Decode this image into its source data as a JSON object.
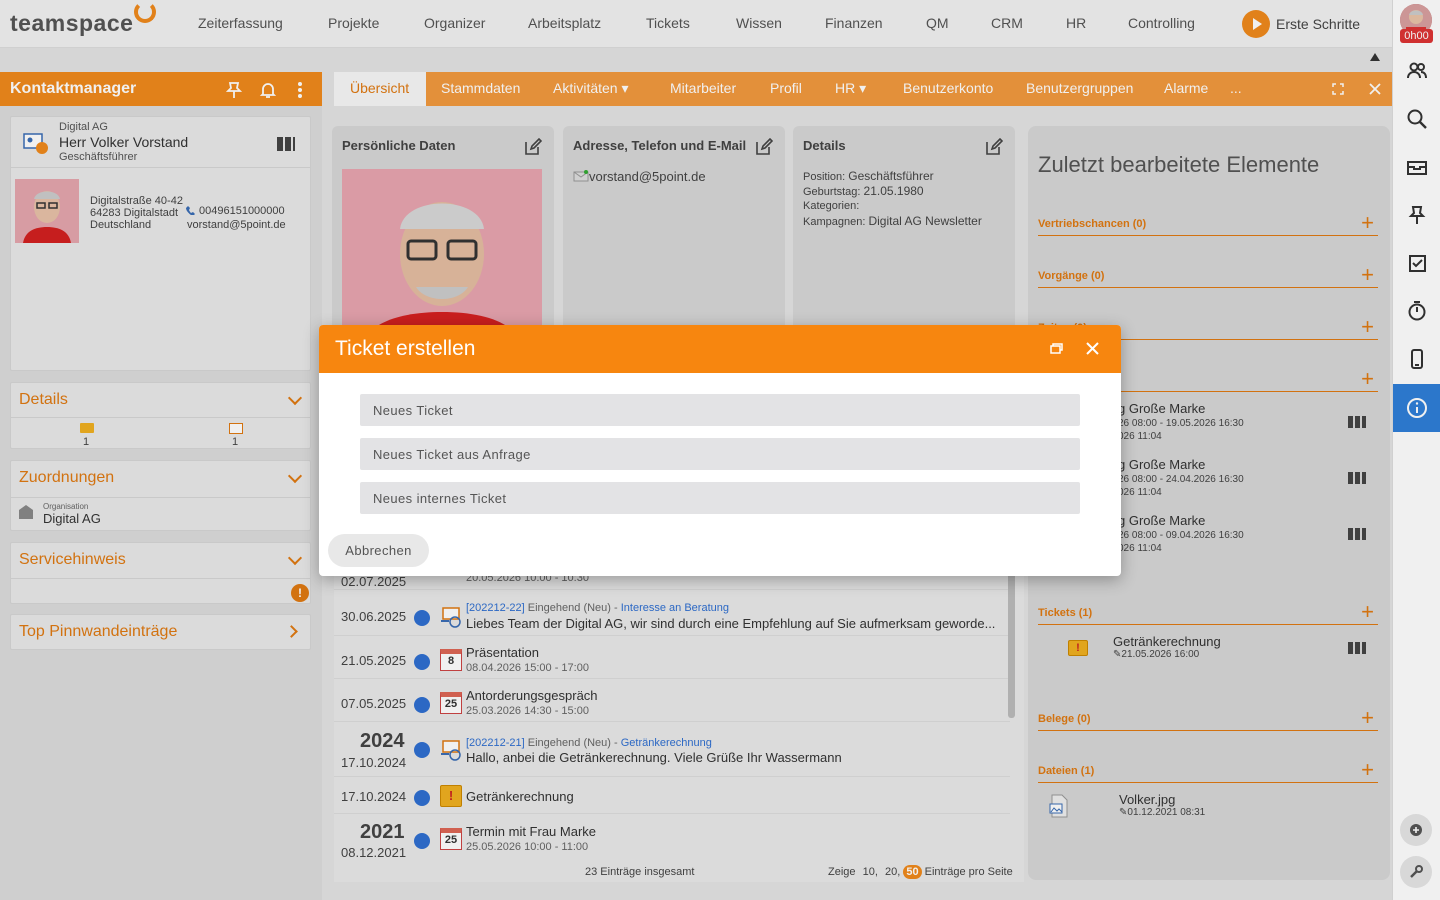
{
  "app": {
    "logo": "teamspace"
  },
  "topnav": {
    "items": [
      "Zeiterfassung",
      "Projekte",
      "Organizer",
      "Arbeitsplatz",
      "Tickets",
      "Wissen",
      "Finanzen",
      "QM",
      "CRM",
      "HR",
      "Controlling"
    ],
    "erste_schritte": "Erste Schritte",
    "time_badge": "0h00"
  },
  "left": {
    "panel_title": "Kontaktmanager",
    "contact": {
      "org": "Digital AG",
      "name": "Herr Volker Vorstand",
      "role": "Geschäftsführer",
      "street": "Digitalstraße 40-42",
      "city": "64283 Digitalstadt",
      "country": "Deutschland",
      "phone": "00496151000000",
      "email": "vorstand@5point.de"
    },
    "details": {
      "title": "Details",
      "count1": "1",
      "count2": "1"
    },
    "zuordnungen": {
      "title": "Zuordnungen",
      "type": "Organisation",
      "value": "Digital AG"
    },
    "servicehinweis": {
      "title": "Servicehinweis"
    },
    "pinnwand": {
      "title": "Top Pinnwandeinträge"
    }
  },
  "tabs": [
    "Übersicht",
    "Stammdaten",
    "Aktivitäten ▾",
    "Mitarbeiter",
    "Profil",
    "HR ▾",
    "Benutzerkonto",
    "Benutzergruppen",
    "Alarme",
    "..."
  ],
  "boxes": {
    "personal": {
      "title": "Persönliche Daten"
    },
    "address": {
      "title": "Adresse, Telefon und E-Mail",
      "email": "vorstand@5point.de"
    },
    "details": {
      "title": "Details",
      "position_label": "Position:",
      "position": "Geschäftsführer",
      "birthday_label": "Geburtstag:",
      "birthday": "21.05.1980",
      "kategorien_label": "Kategorien:",
      "kampagnen_label": "Kampagnen:",
      "kampagnen": "Digital AG Newsletter"
    }
  },
  "recent": {
    "title": "Zuletzt bearbeitete Elemente",
    "sections": {
      "vertrieb": "Vertriebschancen (0)",
      "vorgaenge": "Vorgänge (0)",
      "zeiten": "Zeiten (0)",
      "tickets": "Tickets (1)",
      "belege": "Belege (0)",
      "dateien": "Dateien (1)"
    },
    "termine": [
      {
        "title": "g Große Marke",
        "range": "26 08:00 - 19.05.2026 16:30",
        "edited": "026 11:04"
      },
      {
        "title": "g Große Marke",
        "range": "26 08:00 - 24.04.2026 16:30",
        "edited": "026 11:04"
      },
      {
        "title": "g Große Marke",
        "range": "26 08:00 - 09.04.2026 16:30",
        "edited": "026 11:04"
      }
    ],
    "ticket": {
      "title": "Getränkerechnung",
      "date": "21.05.2026 16:00"
    },
    "file": {
      "title": "Volker.jpg",
      "date": "01.12.2021 08:31"
    }
  },
  "feed": {
    "rows": [
      {
        "date": "02.07.2025",
        "sub": "20.05.2026 10:00 - 10:30"
      },
      {
        "date": "30.06.2025",
        "ref": "[202212-22]",
        "status": "Eingehend (Neu) -",
        "topic": "Interesse an Beratung",
        "text": "Liebes Team der Digital AG, wir sind durch eine Empfehlung auf Sie aufmerksam geworde..."
      },
      {
        "date": "21.05.2025",
        "cal": "8",
        "text": "Präsentation",
        "sub": "08.04.2026 15:00 - 17:00"
      },
      {
        "date": "07.05.2025",
        "cal": "25",
        "text": "Antorderungsgespräch",
        "sub": "25.03.2026 14:30 - 15:00"
      },
      {
        "year": "2024",
        "date": "17.10.2024",
        "ref": "[202212-21]",
        "status": "Eingehend (Neu) -",
        "topic": "Getränkerechnung",
        "text": "Hallo, anbei die Getränkerechnung. Viele Grüße Ihr Wassermann"
      },
      {
        "date": "17.10.2024",
        "text": "Getränkerechnung"
      },
      {
        "year": "2021",
        "date": "08.12.2021",
        "cal": "25",
        "text": "Termin mit Frau Marke",
        "sub": "25.05.2026 10:00 - 11:00"
      }
    ],
    "total": "23 Einträge insgesamt",
    "zeige": "Zeige",
    "opt1": "10",
    "opt2": "20",
    "opt3": "50",
    "per_page": "Einträge pro Seite"
  },
  "dialog": {
    "title": "Ticket erstellen",
    "options": [
      "Neues Ticket",
      "Neues Ticket aus Anfrage",
      "Neues internes Ticket"
    ],
    "cancel": "Abbrechen"
  },
  "colors": {
    "accent": "#f7860f",
    "active_blue": "#2f7fd8"
  }
}
